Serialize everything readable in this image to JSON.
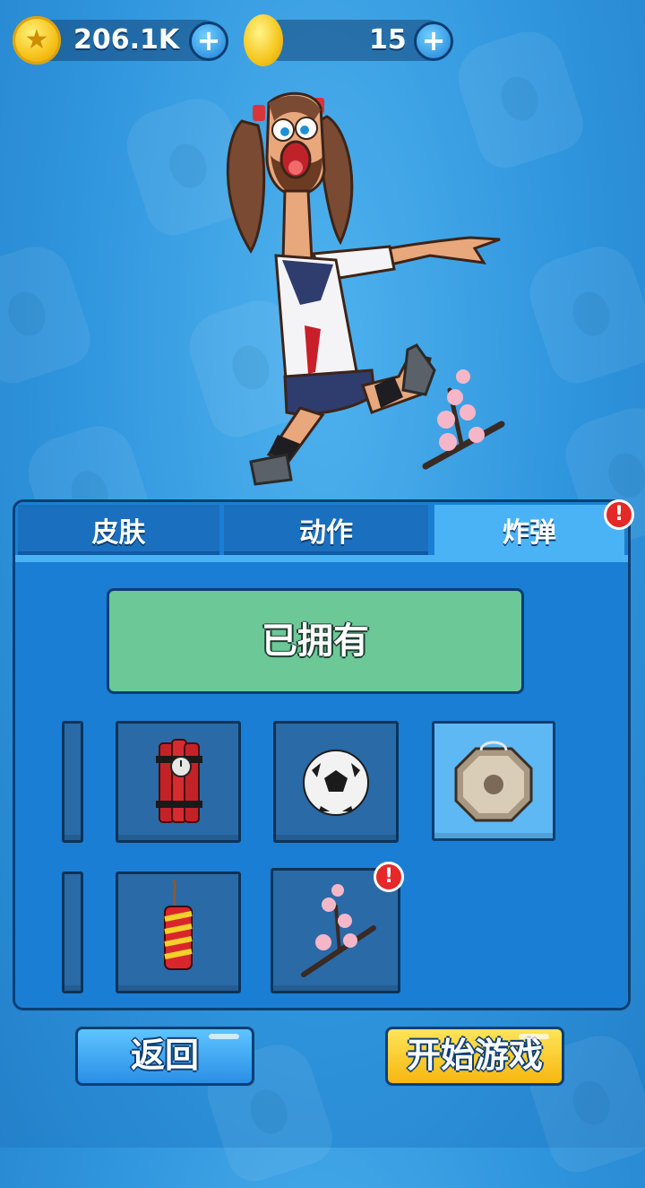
{
  "currency": {
    "coins": "206.1K",
    "gems": "15",
    "coin_icon": "star-coin-icon",
    "gem_icon": "gold-egg-icon",
    "plus_label": "+"
  },
  "tabs": [
    {
      "label": "皮肤",
      "active": false
    },
    {
      "label": "动作",
      "active": false
    },
    {
      "label": "炸弹",
      "active": true,
      "alert": "!"
    }
  ],
  "owned_label": "已拥有",
  "items": [
    {
      "icon": "dynamite-icon"
    },
    {
      "icon": "soccer-ball-icon"
    },
    {
      "icon": "gong-icon",
      "selected": true
    },
    {
      "icon": "firecracker-icon"
    },
    {
      "icon": "cherry-blossom-branch-icon",
      "alert": "!"
    }
  ],
  "buttons": {
    "back": "返回",
    "start": "开始游戏"
  },
  "colors": {
    "panel": "#1a7fd4",
    "active_tab": "#4ab3f5",
    "owned_banner": "#6cc897",
    "start_button": "#f7b710",
    "alert": "#e52828"
  }
}
